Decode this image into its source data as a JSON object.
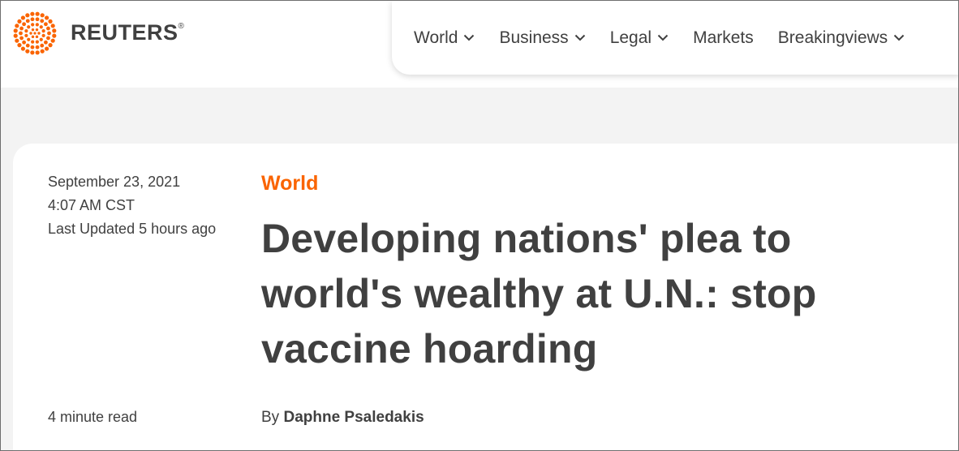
{
  "brand": {
    "name": "REUTERS",
    "registered_mark": "®",
    "accent_color": "#fa6400"
  },
  "nav": {
    "items": [
      {
        "label": "World",
        "has_dropdown": true
      },
      {
        "label": "Business",
        "has_dropdown": true
      },
      {
        "label": "Legal",
        "has_dropdown": true
      },
      {
        "label": "Markets",
        "has_dropdown": false
      },
      {
        "label": "Breakingviews",
        "has_dropdown": true
      }
    ]
  },
  "article": {
    "date": "September 23, 2021",
    "time": "4:07 AM CST",
    "last_updated": "Last Updated 5 hours ago",
    "read_time": "4 minute read",
    "section": "World",
    "headline": "Developing nations' plea to world's wealthy at U.N.: stop vaccine hoarding",
    "byline_prefix": "By",
    "author": "Daphne Psaledakis"
  }
}
